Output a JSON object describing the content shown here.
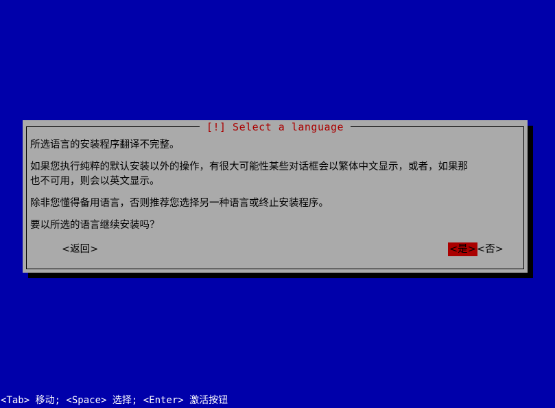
{
  "screen": {
    "background_color": "#0000aa",
    "foreground_color": "#ffffff"
  },
  "dialog": {
    "title": "[!] Select a language",
    "title_color": "#aa0000",
    "background_color": "#aaaaaa",
    "border_color": "#000000",
    "paragraphs": [
      "所选语言的安装程序翻译不完整。",
      "如果您执行纯粹的默认安装以外的操作，有很大可能性某些对话框会以繁体中文显示，或者，如果那\n也不可用，则会以英文显示。",
      "除非您懂得备用语言，否则推荐您选择另一种语言或终止安装程序。",
      "要以所选的语言继续安装吗？"
    ],
    "buttons": [
      {
        "label": "<返回>",
        "selected": false
      },
      {
        "label": "<是>",
        "selected": true,
        "highlight_color": "#aa0000"
      },
      {
        "label": "<否>",
        "selected": false
      }
    ]
  },
  "statusbar": {
    "text": "<Tab> 移动; <Space> 选择; <Enter> 激活按钮"
  }
}
